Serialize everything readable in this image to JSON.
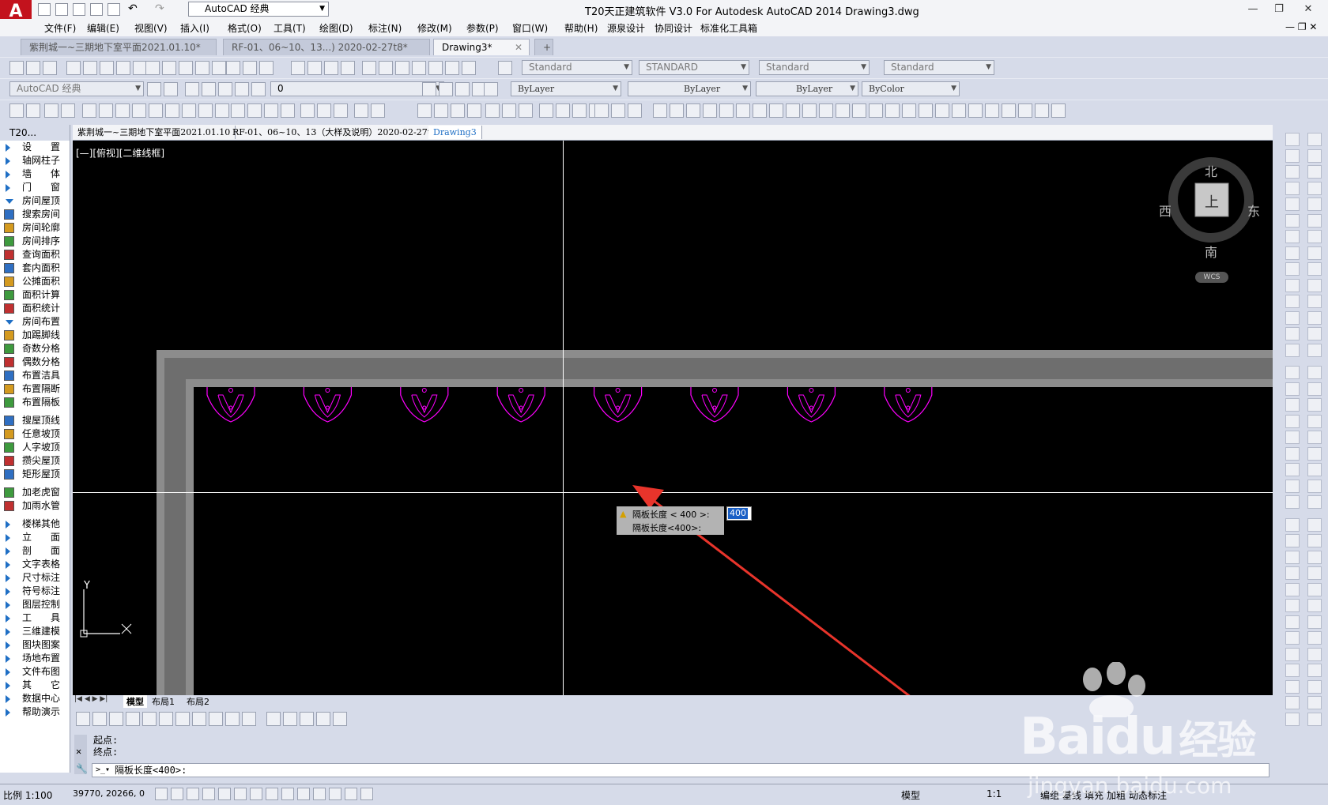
{
  "titlebar": {
    "workspace": "AutoCAD 经典",
    "title": "T20天正建筑软件 V3.0 For Autodesk AutoCAD 2014     Drawing3.dwg",
    "minimize": "—",
    "restore": "❐",
    "close": "✕"
  },
  "menu": [
    "文件(F)",
    "编辑(E)",
    "视图(V)",
    "插入(I)",
    "格式(O)",
    "工具(T)",
    "绘图(D)",
    "标注(N)",
    "修改(M)",
    "参数(P)",
    "窗口(W)",
    "帮助(H)",
    "源泉设计",
    "协同设计",
    "标准化工具箱"
  ],
  "doc_tabs": [
    {
      "label": "紫荆城一~三期地下室平面2021.01.10*",
      "active": false
    },
    {
      "label": "RF-01、06~10、13...) 2020-02-27t8*",
      "active": false
    },
    {
      "label": "Drawing3*",
      "active": true
    }
  ],
  "toolbar": {
    "text_style": "Standard",
    "dim_style": "STANDARD",
    "table_style": "Standard",
    "mleader_style": "Standard",
    "workspace2": "AutoCAD 经典",
    "layer": "0",
    "color": "ByLayer",
    "linetype": "ByLayer",
    "lineweight": "ByLayer",
    "plotstyle": "ByColor"
  },
  "left_panel": {
    "title": "T20...",
    "items": [
      {
        "label": "设　　置",
        "kind": "section"
      },
      {
        "label": "轴网柱子",
        "kind": "section"
      },
      {
        "label": "墙　　体",
        "kind": "section"
      },
      {
        "label": "门　　窗",
        "kind": "section"
      },
      {
        "label": "房间屋顶",
        "kind": "open"
      },
      {
        "label": "搜索房间",
        "kind": "cmd"
      },
      {
        "label": "房间轮廓",
        "kind": "cmd"
      },
      {
        "label": "房间排序",
        "kind": "cmd"
      },
      {
        "label": "查询面积",
        "kind": "cmd"
      },
      {
        "label": "套内面积",
        "kind": "cmd"
      },
      {
        "label": "公摊面积",
        "kind": "cmd"
      },
      {
        "label": "面积计算",
        "kind": "cmd"
      },
      {
        "label": "面积统计",
        "kind": "cmd"
      },
      {
        "label": "房间布置",
        "kind": "open"
      },
      {
        "label": "加踢脚线",
        "kind": "cmd"
      },
      {
        "label": "奇数分格",
        "kind": "cmd"
      },
      {
        "label": "偶数分格",
        "kind": "cmd"
      },
      {
        "label": "布置洁具",
        "kind": "cmd"
      },
      {
        "label": "布置隔断",
        "kind": "cmd"
      },
      {
        "label": "布置隔板",
        "kind": "cmd"
      },
      {
        "label": "",
        "kind": "gap"
      },
      {
        "label": "搜屋顶线",
        "kind": "cmd"
      },
      {
        "label": "任意坡顶",
        "kind": "cmd"
      },
      {
        "label": "人字坡顶",
        "kind": "cmd"
      },
      {
        "label": "攒尖屋顶",
        "kind": "cmd"
      },
      {
        "label": "矩形屋顶",
        "kind": "cmd"
      },
      {
        "label": "",
        "kind": "gap"
      },
      {
        "label": "加老虎窗",
        "kind": "cmd"
      },
      {
        "label": "加雨水管",
        "kind": "cmd"
      },
      {
        "label": "",
        "kind": "gap"
      },
      {
        "label": "楼梯其他",
        "kind": "section"
      },
      {
        "label": "立　　面",
        "kind": "section"
      },
      {
        "label": "剖　　面",
        "kind": "section"
      },
      {
        "label": "文字表格",
        "kind": "section"
      },
      {
        "label": "尺寸标注",
        "kind": "section"
      },
      {
        "label": "符号标注",
        "kind": "section"
      },
      {
        "label": "图层控制",
        "kind": "section"
      },
      {
        "label": "工　　具",
        "kind": "section"
      },
      {
        "label": "三维建模",
        "kind": "section"
      },
      {
        "label": "图块图案",
        "kind": "section"
      },
      {
        "label": "场地布置",
        "kind": "section"
      },
      {
        "label": "文件布图",
        "kind": "section"
      },
      {
        "label": "其　　它",
        "kind": "section"
      },
      {
        "label": "数据中心",
        "kind": "section"
      },
      {
        "label": "帮助演示",
        "kind": "section"
      }
    ]
  },
  "drawing_tabs": [
    {
      "label": "紫荆城一~三期地下室平面2021.01.10",
      "active": false
    },
    {
      "label": "RF-01、06~10、13（大样及说明）2020-02-27t8",
      "active": false
    },
    {
      "label": "Drawing3",
      "active": true
    }
  ],
  "canvas": {
    "view_label": "[—][俯视][二维线框]",
    "compass": {
      "north": "北",
      "south": "南",
      "east": "东",
      "west": "西",
      "top": "上",
      "wcs": "WCS"
    },
    "ucs": {
      "x": "X",
      "y": "Y"
    },
    "urinal_count": 8
  },
  "dynamic_input": {
    "line1": "隔板长度 < 400 >:",
    "line2": "隔板长度<400>:",
    "value": "400"
  },
  "layout_tabs": [
    "模型",
    "布局1",
    "布局2"
  ],
  "command": {
    "history": [
      "起点:",
      "终点:"
    ],
    "prompt": "隔板长度<400>:"
  },
  "status": {
    "scale": "比例 1:100",
    "coords": "39770, 20266, 0",
    "model": "模型",
    "anno_scale": "1:1",
    "right_labels": [
      "编组",
      "基线",
      "填充",
      "加粗",
      "动态标注"
    ]
  },
  "watermark": {
    "brand": "Bai",
    "brand2": "du",
    "suffix": "经验",
    "url": "jingyan.baidu.com"
  },
  "colors": {
    "canvas": "#000000",
    "wall": "#8c8c8c",
    "fixture": "#ff00ff",
    "accent": "#1f6fc5",
    "arrow": "#e8342b"
  }
}
